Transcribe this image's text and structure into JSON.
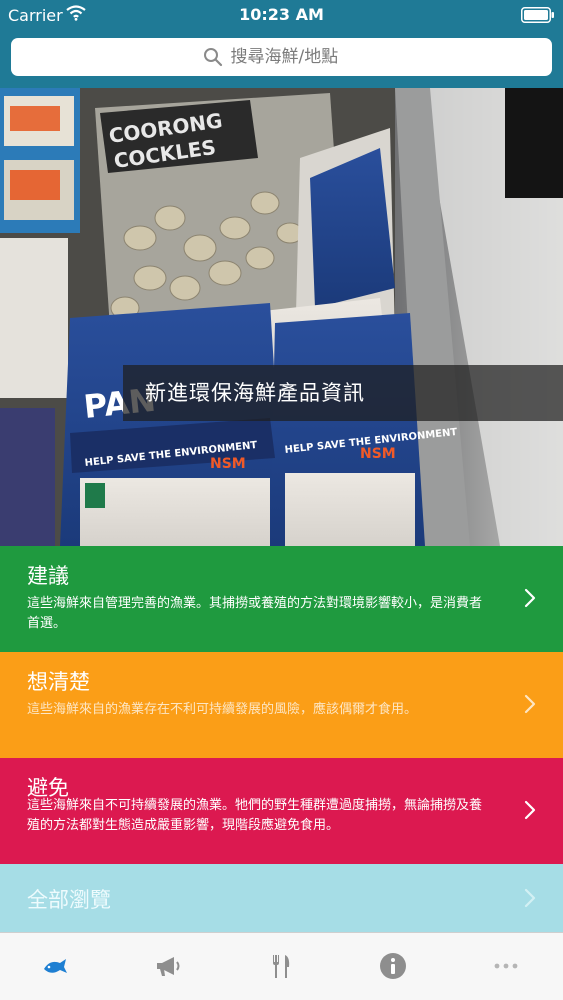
{
  "status_bar": {
    "carrier": "Carrier",
    "time": "10:23 AM"
  },
  "search": {
    "placeholder": "搜尋海鮮/地點"
  },
  "hero": {
    "caption": "新進環保海鮮產品資訊"
  },
  "categories": [
    {
      "title": "建議",
      "description": "這些海鮮來自管理完善的漁業。其捕撈或養殖的方法對環境影響較小，是消費者首選。",
      "color": "#1f9a3f"
    },
    {
      "title": "想清楚",
      "description": "這些海鮮來自的漁業存在不利可持續發展的風險，應該偶爾才食用。",
      "color": "#fb9e17"
    },
    {
      "title": "避免",
      "description": "這些海鮮來自不可持續發展的漁業。牠們的野生種群遭過度捕撈，無論捕撈及養殖的方法都對生態造成嚴重影響，現階段應避免食用。",
      "color": "#dc1950"
    }
  ],
  "browse_all": {
    "title": "全部瀏覽",
    "color": "#a6dde6"
  },
  "tab_bar": {
    "tabs": [
      {
        "icon": "fish-icon",
        "active": true
      },
      {
        "icon": "megaphone-icon",
        "active": false
      },
      {
        "icon": "utensils-icon",
        "active": false
      },
      {
        "icon": "info-icon",
        "active": false
      },
      {
        "icon": "more-icon",
        "active": false
      }
    ],
    "active_color": "#1e7fd2",
    "inactive_color": "#8e8e8e"
  },
  "theme": {
    "header_color": "#1f7a96"
  }
}
